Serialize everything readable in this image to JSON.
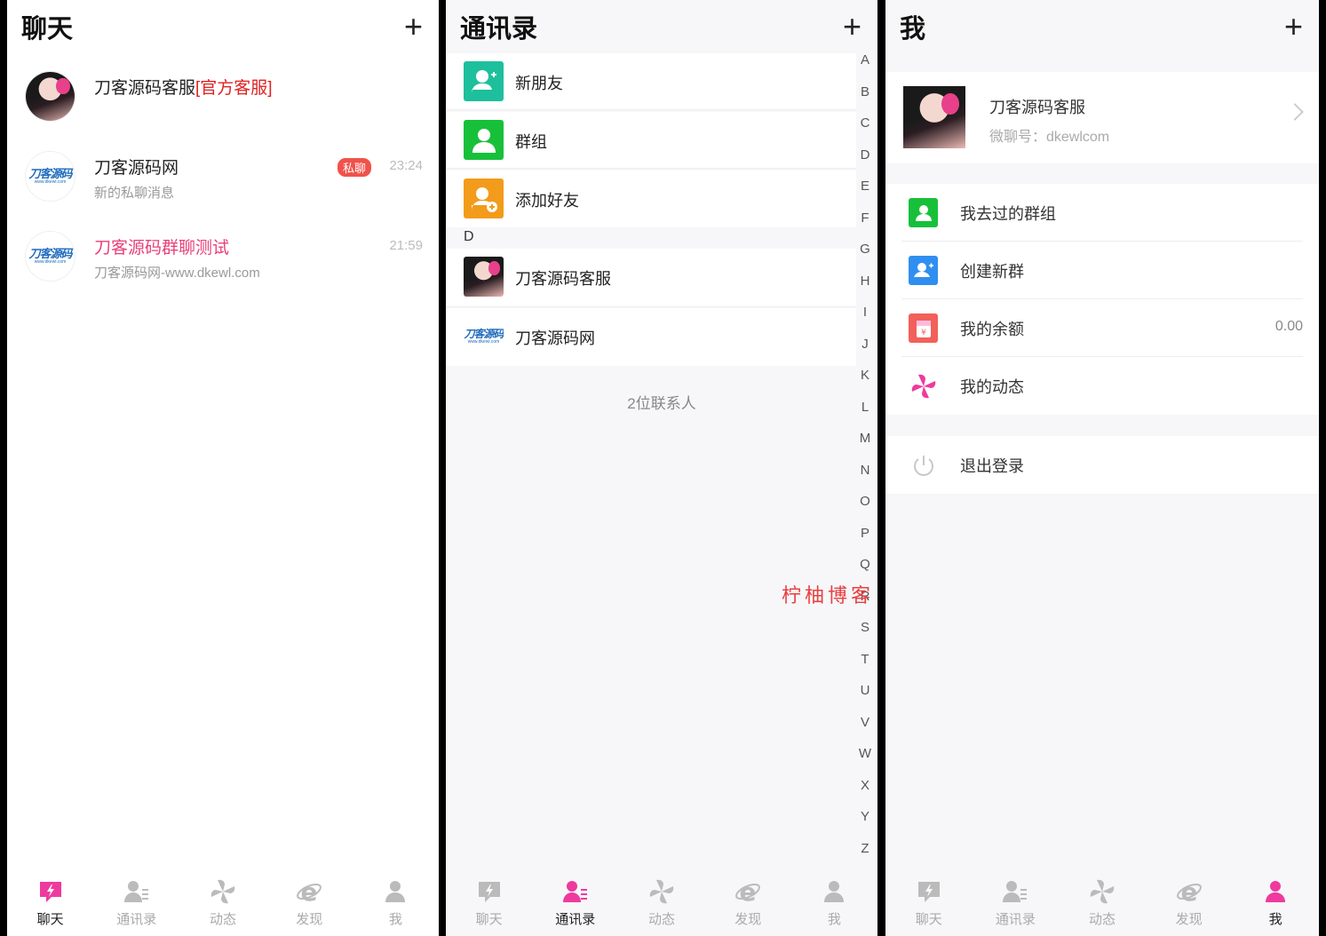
{
  "colors": {
    "accent": "#ee3a9e",
    "inactive": "#b9b9b9",
    "teal": "#1dbf9c",
    "green": "#18c03a",
    "orange": "#f39b1a",
    "blue": "#2f8ff0",
    "red": "#f2605a"
  },
  "tabs": [
    {
      "label": "聊天",
      "icon": "chat-bolt-icon"
    },
    {
      "label": "通讯录",
      "icon": "contacts-icon"
    },
    {
      "label": "动态",
      "icon": "pinwheel-icon"
    },
    {
      "label": "发现",
      "icon": "browser-e-icon"
    },
    {
      "label": "我",
      "icon": "person-icon"
    }
  ],
  "chat": {
    "title": "聊天",
    "plus": "+",
    "items": [
      {
        "name": "刀客源码客服",
        "tag": "[官方客服]",
        "preview": "",
        "time": "",
        "badge": ""
      },
      {
        "name": "刀客源码网",
        "preview": "新的私聊消息",
        "time": "23:24",
        "badge": "私聊"
      },
      {
        "name": "刀客源码群聊测试",
        "preview": "刀客源码网-www.dkewl.com",
        "time": "21:59",
        "badge": ""
      }
    ],
    "logo_text": "刀客源码",
    "logo_sub": "www.dkewl.com"
  },
  "contacts": {
    "title": "通讯录",
    "plus": "+",
    "fixed": [
      {
        "label": "新朋友",
        "icon": "add-person-icon"
      },
      {
        "label": "群组",
        "icon": "group-icon"
      },
      {
        "label": "添加好友",
        "icon": "add-friend-icon"
      }
    ],
    "section": "D",
    "people": [
      {
        "label": "刀客源码客服"
      },
      {
        "label": "刀客源码网"
      }
    ],
    "count": "2位联系人",
    "index": [
      "A",
      "B",
      "C",
      "D",
      "E",
      "F",
      "G",
      "H",
      "I",
      "J",
      "K",
      "L",
      "M",
      "N",
      "O",
      "P",
      "Q",
      "R",
      "S",
      "T",
      "U",
      "V",
      "W",
      "X",
      "Y",
      "Z"
    ],
    "watermark": "柠柚博客"
  },
  "me": {
    "title": "我",
    "plus": "+",
    "name": "刀客源码客服",
    "wechat_id": "微聊号：dkewlcom",
    "menu1": [
      {
        "label": "我去过的群组",
        "icon": "group-visited-icon",
        "value": ""
      },
      {
        "label": "创建新群",
        "icon": "create-group-icon",
        "value": ""
      },
      {
        "label": "我的余额",
        "icon": "red-packet-icon",
        "value": "0.00"
      },
      {
        "label": "我的动态",
        "icon": "pinwheel-icon",
        "value": ""
      }
    ],
    "logout": {
      "label": "退出登录",
      "icon": "power-icon"
    }
  }
}
